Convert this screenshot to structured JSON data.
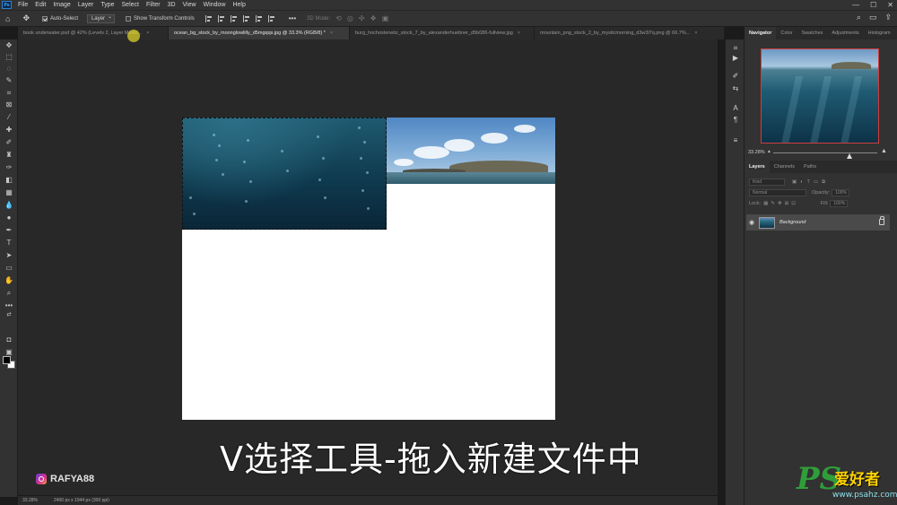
{
  "menubar": {
    "logo": "Ps",
    "items": [
      "File",
      "Edit",
      "Image",
      "Layer",
      "Type",
      "Select",
      "Filter",
      "3D",
      "View",
      "Window",
      "Help"
    ],
    "window_controls": [
      "—",
      "☐",
      "✕"
    ]
  },
  "options": {
    "auto_select_label": "Auto-Select",
    "auto_select_checked": true,
    "target_value": "Layer",
    "show_transform_label": "Show Transform Controls",
    "show_transform_checked": false,
    "more": "•••",
    "mode_3d_label": "3D Mode:"
  },
  "tabs": [
    {
      "label": "book underwater.psd @ 42% (Levels 2, Layer Mask/...",
      "active": false
    },
    {
      "label": "ocean_bg_stock_by_moonglowlilly_d5mgqqs.jpg @ 33.3% (RGB/8) *",
      "active": true
    },
    {
      "label": "burg_hochosterwitz_stock_7_by_alexanderhuebner_d5b086-fullview.jpg",
      "active": false
    },
    {
      "label": "mountain_png_stock_2_by_mysticmorning_d3w3l7q.png @ 66.7%...",
      "active": false
    }
  ],
  "status": {
    "zoom": "33.28%",
    "doc_info": "2400 px x 1944 px (300 ppi)"
  },
  "navigator": {
    "tabs": [
      "Navigator",
      "Color",
      "Swatches",
      "Adjustments",
      "Histogram"
    ],
    "zoom_value": "33.28%",
    "zoom_fraction": 0.33
  },
  "layers": {
    "tabs": [
      "Layers",
      "Channels",
      "Paths"
    ],
    "kind_label": "Kind",
    "blend_mode": "Normal",
    "opacity_label": "Opacity:",
    "opacity_value": "100%",
    "lock_label": "Lock:",
    "fill_label": "Fill:",
    "fill_value": "100%",
    "items": [
      {
        "name": "Background",
        "visible": true,
        "locked": true
      }
    ]
  },
  "overlay": {
    "subtitle": "V选择工具-拖入新建文件中",
    "instagram_handle": "RAFYA88",
    "watermark_ps": "PS",
    "watermark_cn": "爱好者",
    "watermark_url": "www.psahz.com"
  },
  "colors": {
    "app_bg": "#323232",
    "canvas_bg": "#282828",
    "nav_frame": "#d23c3c",
    "watermark_green": "#2f9e3a"
  }
}
